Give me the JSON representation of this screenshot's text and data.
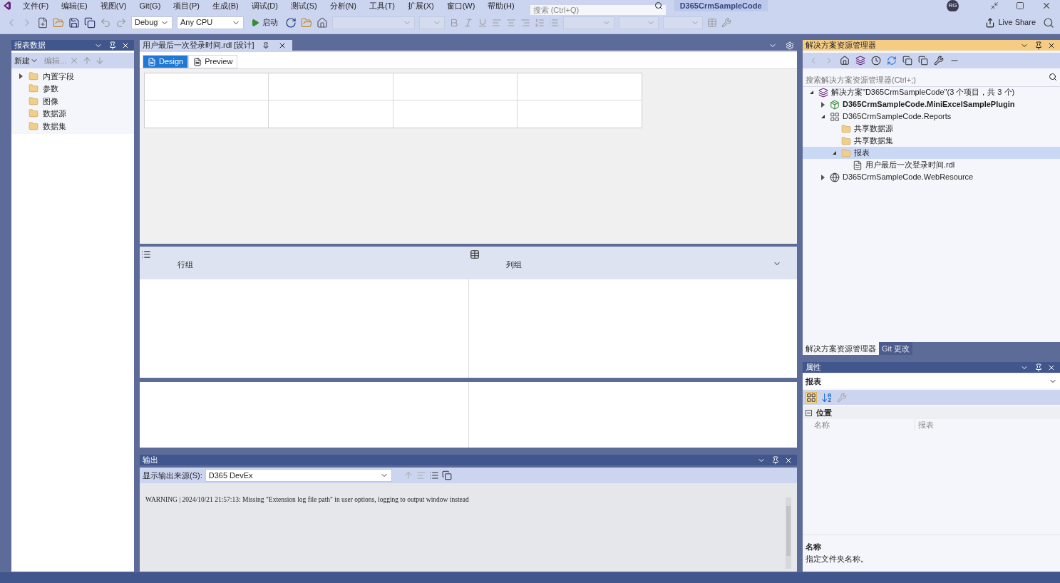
{
  "menu": [
    "文件(F)",
    "编辑(E)",
    "视图(V)",
    "Git(G)",
    "项目(P)",
    "生成(B)",
    "调试(D)",
    "测试(S)",
    "分析(N)",
    "工具(T)",
    "扩展(X)",
    "窗口(W)",
    "帮助(H)"
  ],
  "search": {
    "placeholder": "搜索 (Ctrl+Q)"
  },
  "solution_name": "D365CrmSampleCode",
  "avatar": "RG",
  "toolbar": {
    "configuration": "Debug",
    "platform": "Any CPU",
    "start": "启动",
    "live_share": "Live Share"
  },
  "report_data": {
    "title": "报表数据",
    "new": "新建",
    "edit": "编辑...",
    "items": [
      {
        "label": "内置字段",
        "expandable": true
      },
      {
        "label": "参数",
        "expandable": false
      },
      {
        "label": "图像",
        "expandable": false
      },
      {
        "label": "数据源",
        "expandable": false
      },
      {
        "label": "数据集",
        "expandable": false
      }
    ]
  },
  "document_tab": {
    "title": "用户最后一次登录时间.rdl [设计]"
  },
  "view_tabs": [
    {
      "label": "Design",
      "selected": true
    },
    {
      "label": "Preview",
      "selected": false
    }
  ],
  "grouping": {
    "row_groups": "行组",
    "column_groups": "列组"
  },
  "output": {
    "title": "输出",
    "source_label": "显示输出来源(S):",
    "source": "D365 DevEx",
    "lines": [
      "WARNING | 2024/10/21 21:57:13: Missing \"Extension log file path\" in user options, logging to output window instead"
    ]
  },
  "solution_explorer": {
    "title": "解决方案资源管理器",
    "search_placeholder": "搜索解决方案资源管理器(Ctrl+;)",
    "tree": [
      {
        "label": "解决方案\"D365CrmSampleCode\"(3 个项目，共 3 个)",
        "kind": "solution",
        "expanded": true,
        "bold": false,
        "selected": false,
        "children": [
          {
            "label": "D365CrmSampleCode.MiniExcelSamplePlugin",
            "kind": "csharp",
            "expanded": false,
            "bold": true,
            "selected": false
          },
          {
            "label": "D365CrmSampleCode.Reports",
            "kind": "reports",
            "expanded": true,
            "bold": false,
            "selected": false,
            "children": [
              {
                "label": "共享数据源",
                "kind": "folder",
                "bold": false,
                "selected": false
              },
              {
                "label": "共享数据集",
                "kind": "folder",
                "bold": false,
                "selected": false
              },
              {
                "label": "报表",
                "kind": "folder",
                "expanded": true,
                "bold": false,
                "selected": true,
                "children": [
                  {
                    "label": "用户最后一次登录时间.rdl",
                    "kind": "report",
                    "bold": false,
                    "selected": false
                  }
                ]
              }
            ]
          },
          {
            "label": "D365CrmSampleCode.WebResource",
            "kind": "web",
            "expanded": false,
            "bold": false,
            "selected": false
          }
        ]
      }
    ]
  },
  "bottom_tabs": [
    {
      "label": "解决方案资源管理器",
      "selected": true
    },
    {
      "label": "Git 更改",
      "selected": false
    }
  ],
  "properties": {
    "title": "属性",
    "object": "报表",
    "category": "位置",
    "rows": [
      {
        "name": "名称",
        "value": "报表"
      }
    ],
    "description_title": "名称",
    "description": "指定文件夹名称。"
  }
}
